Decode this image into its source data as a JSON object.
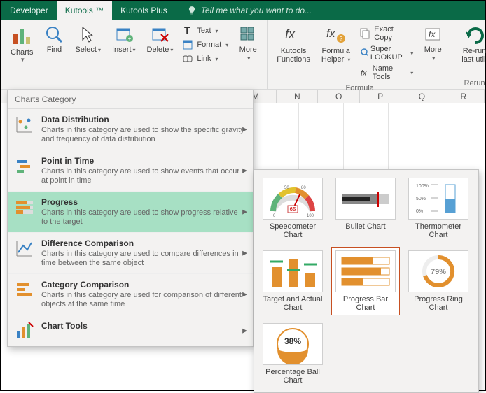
{
  "titlebar": {
    "tabs": {
      "developer": "Developer",
      "kutools": "Kutools ™",
      "kutools_plus": "Kutools Plus"
    },
    "tellme": "Tell me what you want to do..."
  },
  "ribbon": {
    "charts": "Charts",
    "find": "Find",
    "select": "Select",
    "insert": "Insert",
    "delete": "Delete",
    "text": "Text",
    "format": "Format",
    "link": "Link",
    "more": "More",
    "kfunctions": "Kutools\nFunctions",
    "fhelper": "Formula\nHelper",
    "exact_copy": "Exact Copy",
    "super_lookup": "Super LOOKUP",
    "name_tools": "Name Tools",
    "more2": "More",
    "rerun": "Re-run\nlast utili",
    "group_formula": "Formula",
    "group_rerun": "Rerun"
  },
  "dropdown": {
    "title": "Charts Category",
    "items": [
      {
        "title": "Data Distribution",
        "desc": "Charts in this category are used to show the specific gravity and frequency of data distribution"
      },
      {
        "title": "Point in Time",
        "desc": "Charts in this category are used to show events that occur at point in time"
      },
      {
        "title": "Progress",
        "desc": "Charts in this category are used to show progress relative to the target"
      },
      {
        "title": "Difference Comparison",
        "desc": "Charts in this category are used to compare differences in time between the same object"
      },
      {
        "title": "Category Comparison",
        "desc": "Charts in this category are used for comparison of different objects at the same time"
      },
      {
        "title": "Chart Tools",
        "desc": ""
      }
    ]
  },
  "gallery": {
    "items": [
      {
        "label": "Speedometer\nChart"
      },
      {
        "label": "Bullet Chart"
      },
      {
        "label": "Thermometer Chart"
      },
      {
        "label": "Target and Actual\nChart"
      },
      {
        "label": "Progress Bar\nChart"
      },
      {
        "label": "Progress Ring\nChart"
      },
      {
        "label": "Percentage Ball\nChart"
      }
    ],
    "thumb_text": {
      "speedo_value": "65",
      "speedo_min": "0",
      "speedo_50": "50",
      "speedo_80": "80",
      "speedo_100": "100",
      "thermo_100": "100%",
      "thermo_50": "50%",
      "thermo_0": "0%",
      "ring": "79%",
      "ball": "38%"
    }
  },
  "sheet": {
    "cols": [
      "M",
      "N",
      "O",
      "P",
      "Q",
      "R"
    ]
  }
}
